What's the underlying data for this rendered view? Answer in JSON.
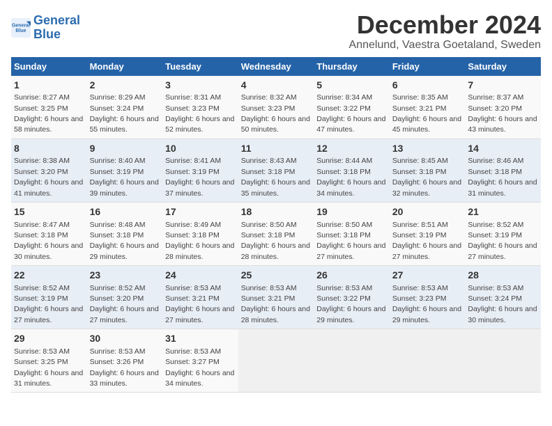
{
  "header": {
    "logo_line1": "General",
    "logo_line2": "Blue",
    "title": "December 2024",
    "subtitle": "Annelund, Vaestra Goetaland, Sweden"
  },
  "weekdays": [
    "Sunday",
    "Monday",
    "Tuesday",
    "Wednesday",
    "Thursday",
    "Friday",
    "Saturday"
  ],
  "weeks": [
    [
      {
        "day": "1",
        "sunrise": "8:27 AM",
        "sunset": "3:25 PM",
        "daylight": "6 hours and 58 minutes."
      },
      {
        "day": "2",
        "sunrise": "8:29 AM",
        "sunset": "3:24 PM",
        "daylight": "6 hours and 55 minutes."
      },
      {
        "day": "3",
        "sunrise": "8:31 AM",
        "sunset": "3:23 PM",
        "daylight": "6 hours and 52 minutes."
      },
      {
        "day": "4",
        "sunrise": "8:32 AM",
        "sunset": "3:23 PM",
        "daylight": "6 hours and 50 minutes."
      },
      {
        "day": "5",
        "sunrise": "8:34 AM",
        "sunset": "3:22 PM",
        "daylight": "6 hours and 47 minutes."
      },
      {
        "day": "6",
        "sunrise": "8:35 AM",
        "sunset": "3:21 PM",
        "daylight": "6 hours and 45 minutes."
      },
      {
        "day": "7",
        "sunrise": "8:37 AM",
        "sunset": "3:20 PM",
        "daylight": "6 hours and 43 minutes."
      }
    ],
    [
      {
        "day": "8",
        "sunrise": "8:38 AM",
        "sunset": "3:20 PM",
        "daylight": "6 hours and 41 minutes."
      },
      {
        "day": "9",
        "sunrise": "8:40 AM",
        "sunset": "3:19 PM",
        "daylight": "6 hours and 39 minutes."
      },
      {
        "day": "10",
        "sunrise": "8:41 AM",
        "sunset": "3:19 PM",
        "daylight": "6 hours and 37 minutes."
      },
      {
        "day": "11",
        "sunrise": "8:43 AM",
        "sunset": "3:18 PM",
        "daylight": "6 hours and 35 minutes."
      },
      {
        "day": "12",
        "sunrise": "8:44 AM",
        "sunset": "3:18 PM",
        "daylight": "6 hours and 34 minutes."
      },
      {
        "day": "13",
        "sunrise": "8:45 AM",
        "sunset": "3:18 PM",
        "daylight": "6 hours and 32 minutes."
      },
      {
        "day": "14",
        "sunrise": "8:46 AM",
        "sunset": "3:18 PM",
        "daylight": "6 hours and 31 minutes."
      }
    ],
    [
      {
        "day": "15",
        "sunrise": "8:47 AM",
        "sunset": "3:18 PM",
        "daylight": "6 hours and 30 minutes."
      },
      {
        "day": "16",
        "sunrise": "8:48 AM",
        "sunset": "3:18 PM",
        "daylight": "6 hours and 29 minutes."
      },
      {
        "day": "17",
        "sunrise": "8:49 AM",
        "sunset": "3:18 PM",
        "daylight": "6 hours and 28 minutes."
      },
      {
        "day": "18",
        "sunrise": "8:50 AM",
        "sunset": "3:18 PM",
        "daylight": "6 hours and 28 minutes."
      },
      {
        "day": "19",
        "sunrise": "8:50 AM",
        "sunset": "3:18 PM",
        "daylight": "6 hours and 27 minutes."
      },
      {
        "day": "20",
        "sunrise": "8:51 AM",
        "sunset": "3:19 PM",
        "daylight": "6 hours and 27 minutes."
      },
      {
        "day": "21",
        "sunrise": "8:52 AM",
        "sunset": "3:19 PM",
        "daylight": "6 hours and 27 minutes."
      }
    ],
    [
      {
        "day": "22",
        "sunrise": "8:52 AM",
        "sunset": "3:19 PM",
        "daylight": "6 hours and 27 minutes."
      },
      {
        "day": "23",
        "sunrise": "8:52 AM",
        "sunset": "3:20 PM",
        "daylight": "6 hours and 27 minutes."
      },
      {
        "day": "24",
        "sunrise": "8:53 AM",
        "sunset": "3:21 PM",
        "daylight": "6 hours and 27 minutes."
      },
      {
        "day": "25",
        "sunrise": "8:53 AM",
        "sunset": "3:21 PM",
        "daylight": "6 hours and 28 minutes."
      },
      {
        "day": "26",
        "sunrise": "8:53 AM",
        "sunset": "3:22 PM",
        "daylight": "6 hours and 29 minutes."
      },
      {
        "day": "27",
        "sunrise": "8:53 AM",
        "sunset": "3:23 PM",
        "daylight": "6 hours and 29 minutes."
      },
      {
        "day": "28",
        "sunrise": "8:53 AM",
        "sunset": "3:24 PM",
        "daylight": "6 hours and 30 minutes."
      }
    ],
    [
      {
        "day": "29",
        "sunrise": "8:53 AM",
        "sunset": "3:25 PM",
        "daylight": "6 hours and 31 minutes."
      },
      {
        "day": "30",
        "sunrise": "8:53 AM",
        "sunset": "3:26 PM",
        "daylight": "6 hours and 33 minutes."
      },
      {
        "day": "31",
        "sunrise": "8:53 AM",
        "sunset": "3:27 PM",
        "daylight": "6 hours and 34 minutes."
      },
      null,
      null,
      null,
      null
    ]
  ]
}
